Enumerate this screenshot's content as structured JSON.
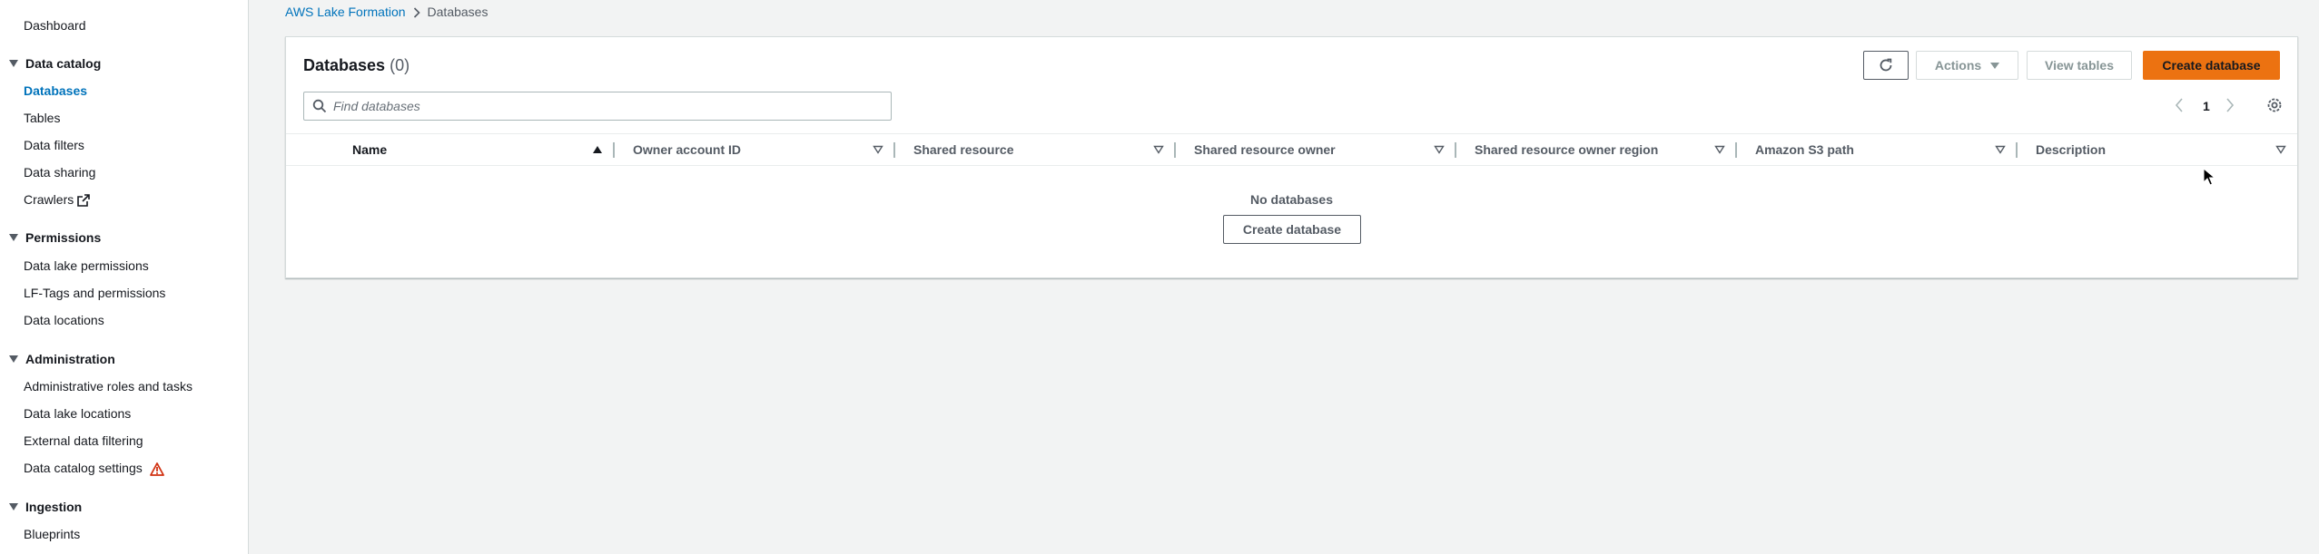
{
  "sidebar": {
    "dashboard": "Dashboard",
    "sections": [
      {
        "title": "Data catalog",
        "items": [
          "Databases",
          "Tables",
          "Data filters",
          "Data sharing",
          "Crawlers"
        ]
      },
      {
        "title": "Permissions",
        "items": [
          "Data lake permissions",
          "LF-Tags and permissions",
          "Data locations"
        ]
      },
      {
        "title": "Administration",
        "items": [
          "Administrative roles and tasks",
          "Data lake locations",
          "External data filtering",
          "Data catalog settings"
        ]
      },
      {
        "title": "Ingestion",
        "items": [
          "Blueprints"
        ]
      }
    ],
    "active_item": "Databases"
  },
  "breadcrumb": {
    "root": "AWS Lake Formation",
    "current": "Databases"
  },
  "panel": {
    "title": "Databases",
    "count": "(0)",
    "actions_label": "Actions",
    "view_tables_label": "View tables",
    "create_label": "Create database",
    "search_placeholder": "Find databases",
    "page_number": "1",
    "columns": [
      "Name",
      "Owner account ID",
      "Shared resource",
      "Shared resource owner",
      "Shared resource owner region",
      "Amazon S3 path",
      "Description"
    ],
    "empty_message": "No databases",
    "empty_create_label": "Create database"
  },
  "colors": {
    "accent": "#0073bb",
    "primary_button": "#ec7211",
    "warning": "#d13212"
  }
}
